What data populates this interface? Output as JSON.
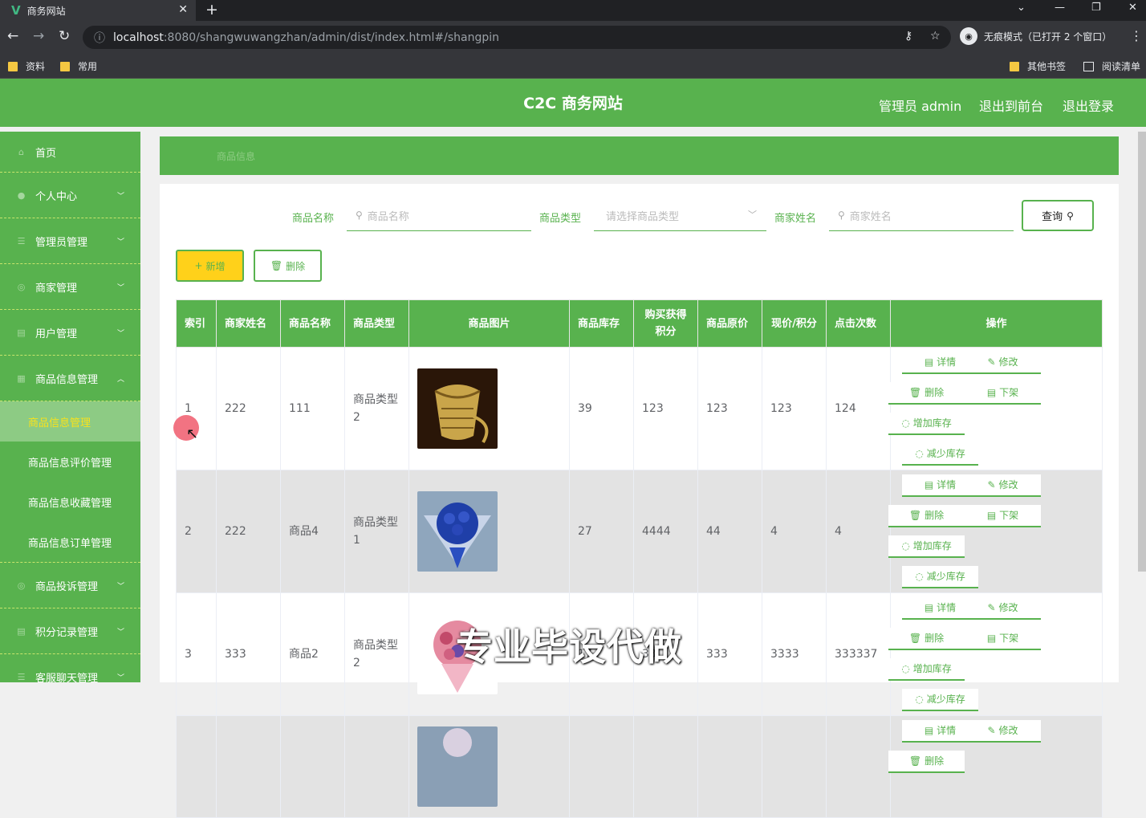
{
  "browser": {
    "tab_title": "商务网站",
    "tab_close": "✕",
    "new_tab": "+",
    "url_host": "localhost",
    "url_path": ":8080/shangwuwangzhan/admin/dist/index.html#/shangpin",
    "incognito_label": "无痕模式（已打开 2 个窗口）",
    "bookmarks": [
      "资料",
      "常用"
    ],
    "other_bookmarks": "其他书签",
    "reading_list": "阅读清单"
  },
  "header": {
    "title": "C2C 商务网站",
    "admin_label": "管理员 admin",
    "back_to_front": "退出到前台",
    "logout": "退出登录"
  },
  "sidebar": {
    "items": [
      {
        "label": "首页"
      },
      {
        "label": "个人中心"
      },
      {
        "label": "管理员管理"
      },
      {
        "label": "商家管理"
      },
      {
        "label": "用户管理"
      },
      {
        "label": "商品信息管理"
      },
      {
        "label": "商品投诉管理"
      },
      {
        "label": "积分记录管理"
      },
      {
        "label": "客服聊天管理"
      }
    ],
    "subitems": [
      "商品信息管理",
      "商品信息评价管理",
      "商品信息收藏管理",
      "商品信息订单管理"
    ]
  },
  "breadcrumb": "商品信息",
  "filters": {
    "name_label": "商品名称",
    "name_placeholder": "商品名称",
    "type_label": "商品类型",
    "type_placeholder": "请选择商品类型",
    "merchant_label": "商家姓名",
    "merchant_placeholder": "商家姓名",
    "query_btn": "查询"
  },
  "actions": {
    "add": "新增",
    "delete": "删除"
  },
  "table": {
    "headers": [
      "索引",
      "商家姓名",
      "商品名称",
      "商品类型",
      "商品图片",
      "商品库存",
      "购买获得积分",
      "商品原价",
      "现价/积分",
      "点击次数",
      "操作"
    ],
    "rows": [
      {
        "idx": "1",
        "merchant": "222",
        "name": "111",
        "type": "商品类型2",
        "stock": "39",
        "points": "123",
        "orig": "123",
        "price": "123",
        "clicks": "124"
      },
      {
        "idx": "2",
        "merchant": "222",
        "name": "商品4",
        "type": "商品类型1",
        "stock": "27",
        "points": "4444",
        "orig": "44",
        "price": "4",
        "clicks": "4"
      },
      {
        "idx": "3",
        "merchant": "333",
        "name": "商品2",
        "type": "商品类型2",
        "stock": "17",
        "points": "33",
        "orig": "333",
        "price": "3333",
        "clicks": "333337"
      }
    ],
    "ops": {
      "detail": "详情",
      "edit": "修改",
      "delete": "删除",
      "offshelf": "下架",
      "add_stock": "增加库存",
      "reduce_stock": "减少库存"
    }
  },
  "watermark": "专业毕设代做",
  "colors": {
    "primary": "#58b24e",
    "accent": "#ffd11a",
    "active_text": "#f8e21c"
  }
}
